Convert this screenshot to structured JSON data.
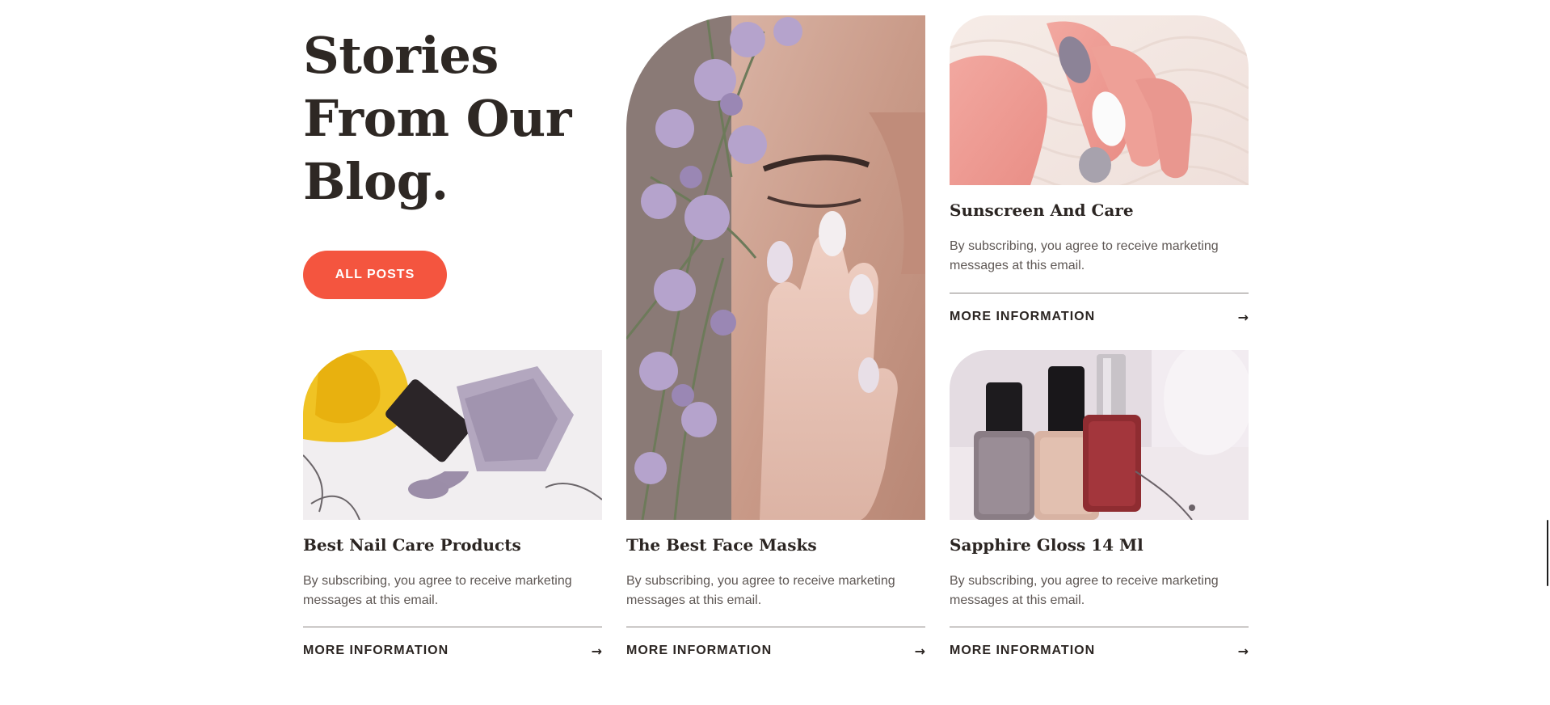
{
  "section": {
    "heading": "Stories From Our Blog.",
    "all_posts_label": "ALL POSTS"
  },
  "theme": {
    "accent": "#f4553f",
    "text_dark": "#2b2522",
    "text_muted": "#5e5754",
    "divider": "#8a8480"
  },
  "cards": [
    {
      "title": "Sunscreen And Care",
      "desc": "By subscribing, you agree to receive marketing messages at this email.",
      "link_label": "MORE INFORMATION",
      "image": "manicured-hand-on-knit-photo"
    },
    {
      "title": "Best Nail Care Products",
      "desc": "By subscribing, you agree to receive marketing messages at this email.",
      "link_label": "MORE INFORMATION",
      "image": "spilled-nail-polish-photo"
    },
    {
      "title": "The Best Face Masks",
      "desc": "By subscribing, you agree to receive marketing messages at this email.",
      "link_label": "MORE INFORMATION",
      "image": "woman-with-flowers-photo"
    },
    {
      "title": "Sapphire Gloss 14 Ml",
      "desc": "By subscribing, you agree to receive marketing messages at this email.",
      "link_label": "MORE INFORMATION",
      "image": "nail-polish-bottles-photo"
    }
  ],
  "icons": {
    "arrow": "→"
  }
}
